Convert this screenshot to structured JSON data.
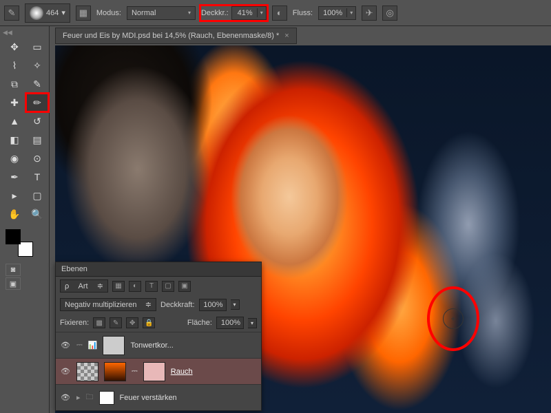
{
  "optbar": {
    "brush_size": "464",
    "mode_label": "Modus:",
    "mode_value": "Normal",
    "opacity_label": "Deckkr.:",
    "opacity_value": "41%",
    "flow_label": "Fluss:",
    "flow_value": "100%"
  },
  "doc": {
    "title": "Feuer und Eis by MDI.psd bei 14,5% (Rauch, Ebenenmaske/8) *"
  },
  "layers": {
    "title": "Ebenen",
    "kind_label": "Art",
    "blend_mode": "Negativ multiplizieren",
    "opacity_label": "Deckkraft:",
    "opacity_value": "100%",
    "lock_label": "Fixieren:",
    "fill_label": "Fläche:",
    "fill_value": "100%",
    "items": [
      {
        "name": "Tonwertkor..."
      },
      {
        "name": "Rauch"
      },
      {
        "name": "Feuer verstärken"
      }
    ]
  }
}
